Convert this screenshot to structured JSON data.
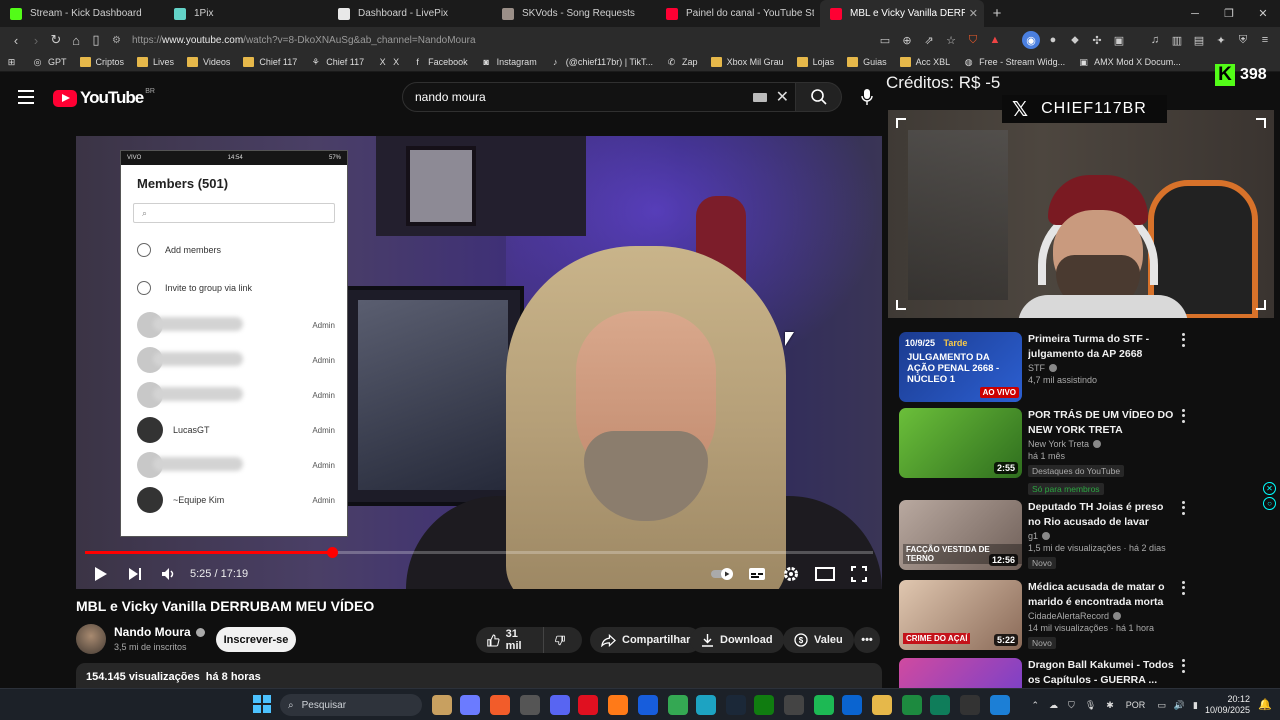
{
  "browser": {
    "tabs": [
      {
        "label": "Stream - Kick Dashboard",
        "icon": "kick-icon",
        "color": "#53fc18",
        "active": false
      },
      {
        "label": "1Pix",
        "icon": "1pix-icon",
        "color": "#63d3c8",
        "active": false
      },
      {
        "label": "Dashboard - LivePix",
        "icon": "livepix-icon",
        "color": "#e8e8e8",
        "active": false
      },
      {
        "label": "SKVods - Song Requests",
        "icon": "skvods-icon",
        "color": "#9b8f88",
        "active": false
      },
      {
        "label": "Painel do canal - YouTube Studio",
        "icon": "youtube-studio-icon",
        "color": "#ff0033",
        "active": false
      },
      {
        "label": "MBL e Vicky Vanilla DERRUBAM",
        "icon": "youtube-icon",
        "color": "#ff0033",
        "active": true
      }
    ],
    "url_prefix": "https://",
    "url_host": "www.youtube.com",
    "url_path": "/watch?v=8-DkoXNAuSg&ab_channel=NandoMoura",
    "bookmarks": [
      {
        "label": "GPT",
        "icon": "gpt-icon"
      },
      {
        "label": "Criptos",
        "icon": "folder-icon"
      },
      {
        "label": "Lives",
        "icon": "folder-icon"
      },
      {
        "label": "Videos",
        "icon": "folder-icon"
      },
      {
        "label": "Chief 117",
        "icon": "folder-icon"
      },
      {
        "label": "Chief 117",
        "icon": "leaf-icon"
      },
      {
        "label": "X",
        "icon": "x-icon"
      },
      {
        "label": "Facebook",
        "icon": "facebook-icon"
      },
      {
        "label": "Instagram",
        "icon": "instagram-icon"
      },
      {
        "label": "(@chief117br) | TikT...",
        "icon": "tiktok-icon"
      },
      {
        "label": "Zap",
        "icon": "whatsapp-icon"
      },
      {
        "label": "Xbox Mil Grau",
        "icon": "folder-icon"
      },
      {
        "label": "Lojas",
        "icon": "folder-icon"
      },
      {
        "label": "Guias",
        "icon": "folder-icon"
      },
      {
        "label": "Acc XBL",
        "icon": "folder-icon"
      },
      {
        "label": "Free - Stream Widg...",
        "icon": "globe-icon"
      },
      {
        "label": "AMX Mod X Docum...",
        "icon": "amx-icon"
      }
    ]
  },
  "youtube": {
    "logo_text": "YouTube",
    "region": "BR",
    "search_value": "nando moura",
    "video": {
      "progress": 0.314,
      "time": "5:25 / 17:19",
      "title": "MBL e Vicky Vanilla DERRUBAM MEU VÍDEO",
      "channel": "Nando Moura",
      "subscribers": "3,5 mi de inscritos",
      "subscribe_label": "Inscrever-se",
      "likes": "31 mil",
      "share_label": "Compartilhar",
      "download_label": "Download",
      "thanks_label": "Valeu",
      "views": "154.145 visualizações",
      "age": "há 8 horas"
    },
    "phone_overlay": {
      "carrier": "VIVO",
      "clock": "14:54",
      "battery": "57%",
      "title": "Members (501)",
      "search_placeholder": "⌕",
      "actions": [
        "Add members",
        "Invite to group via link"
      ],
      "members": [
        {
          "name": "",
          "role": "Admin"
        },
        {
          "name": "",
          "role": "Admin"
        },
        {
          "name": "",
          "role": "Admin"
        },
        {
          "name": "LucasGT",
          "role": "Admin"
        },
        {
          "name": "",
          "role": "Admin"
        },
        {
          "name": "~Equipe Kim",
          "role": "Admin"
        }
      ]
    },
    "recommendations": [
      {
        "title": "Primeira Turma do STF - julgamento da AP 2668 (Núcle...",
        "channel": "STF",
        "meta": "4,7 mil assistindo",
        "duration": "",
        "badges": [],
        "thumb_date": "10/9/25",
        "thumb_tag": "Tarde",
        "thumb_headline": "JULGAMENTO DA AÇÃO PENAL 2668 - NÚCLEO 1",
        "thumb_live": "AO VIVO"
      },
      {
        "title": "POR TRÁS DE UM VÍDEO DO NEW YORK TRETA",
        "channel": "New York Treta",
        "meta": "há 1 mês",
        "duration": "2:55",
        "badges": [
          "Destaques do YouTube",
          "Só para membros"
        ]
      },
      {
        "title": "Deputado TH Joias é preso no Rio acusado de lavar dinheiro ...",
        "channel": "g1",
        "meta": "1,5 mi de visualizações · há 2 dias",
        "duration": "12:56",
        "badges": [
          "Novo"
        ],
        "thumb_headline": "FACÇÃO VESTIDA DE TERNO"
      },
      {
        "title": "Médica acusada de matar o marido é encontrada morta no...",
        "channel": "CidadeAlertaRecord",
        "meta": "14 mil visualizações · há 1 hora",
        "duration": "5:22",
        "badges": [
          "Novo"
        ],
        "thumb_headline": "CRIME DO AÇAÍ"
      },
      {
        "title": "Dragon Ball Kakumei - Todos os Capítulos - GUERRA ...",
        "channel": "",
        "meta": "",
        "duration": "",
        "badges": []
      }
    ]
  },
  "stream_overlay": {
    "credits": "Créditos: R$ -5",
    "kick_count": "398",
    "handle": "CHIEF117BR"
  },
  "taskbar": {
    "search_placeholder": "Pesquisar",
    "lang": "POR",
    "time": "20:12",
    "date": "10/09/2025"
  }
}
